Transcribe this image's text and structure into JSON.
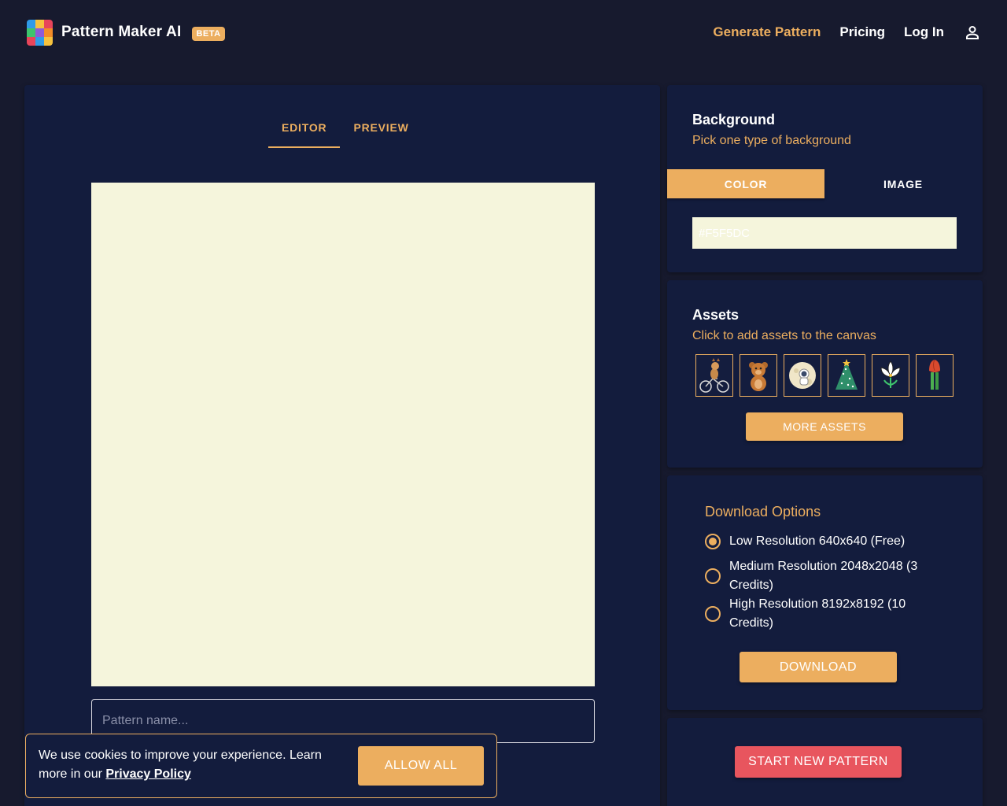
{
  "header": {
    "app_name": "Pattern Maker AI",
    "badge": "BETA",
    "nav": [
      {
        "label": "Generate Pattern",
        "active": true
      },
      {
        "label": "Pricing"
      },
      {
        "label": "Log In"
      }
    ],
    "user_icon": "user-icon"
  },
  "editor": {
    "tabs": [
      {
        "label": "EDITOR",
        "active": true
      },
      {
        "label": "PREVIEW"
      }
    ],
    "canvas_color": "#F5F5DC",
    "pattern_name_placeholder": "Pattern name..."
  },
  "background": {
    "title": "Background",
    "subtitle": "Pick one type of background",
    "tabs": [
      {
        "label": "COLOR",
        "active": true
      },
      {
        "label": "IMAGE"
      }
    ],
    "color_value": "#F5F5DC"
  },
  "assets": {
    "title": "Assets",
    "subtitle": "Click to add assets to the canvas",
    "items": [
      "cyclist-icon",
      "teddy-bear-icon",
      "astronaut-moon-icon",
      "christmas-tree-icon",
      "white-flower-icon",
      "tulip-icon"
    ],
    "more_label": "MORE ASSETS"
  },
  "download": {
    "title": "Download Options",
    "options": [
      {
        "label": "Low Resolution 640x640 (Free)",
        "checked": true
      },
      {
        "label": "Medium Resolution 2048x2048 (3 Credits)",
        "checked": false
      },
      {
        "label": "High Resolution 8192x8192 (10 Credits)",
        "checked": false
      }
    ],
    "button_label": "DOWNLOAD"
  },
  "new_pattern": {
    "button_label": "START NEW PATTERN"
  },
  "cookie": {
    "text": "We use cookies to improve your experience. Learn more in our",
    "link": "Privacy Policy",
    "button_label": "ALLOW ALL"
  },
  "colors": {
    "accent": "#ECAE5F",
    "danger": "#E8555E",
    "panel": "#131C3D",
    "page": "#171A2E"
  }
}
